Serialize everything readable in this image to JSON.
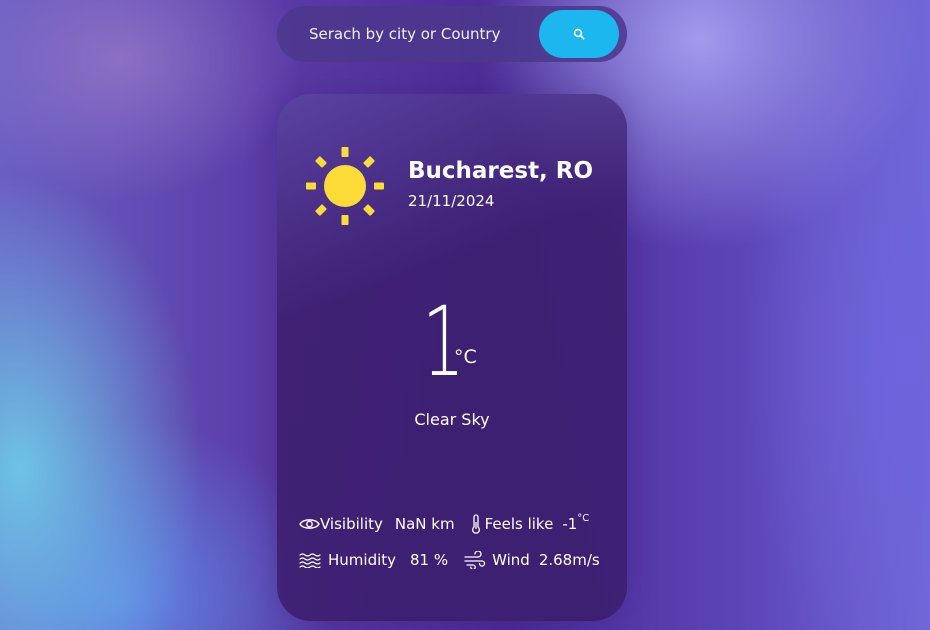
{
  "search": {
    "placeholder": "Serach by city or Country",
    "button_icon": "search-icon"
  },
  "weather": {
    "icon": "sun-icon",
    "location": "Bucharest, RO",
    "date": "21/11/2024",
    "temperature": "1",
    "temperature_unit": "°C",
    "description": "Clear Sky"
  },
  "stats": {
    "visibility_label": "Visibility",
    "visibility_value": "NaN km",
    "feels_like_label": "Feels like",
    "feels_like_value": "-1",
    "feels_like_unit": "°C",
    "humidity_label": "Humidity",
    "humidity_value": "81 %",
    "wind_label": "Wind",
    "wind_value": "2.68m/s"
  },
  "colors": {
    "accent": "#1bb7ee",
    "sun": "#fddb37"
  }
}
